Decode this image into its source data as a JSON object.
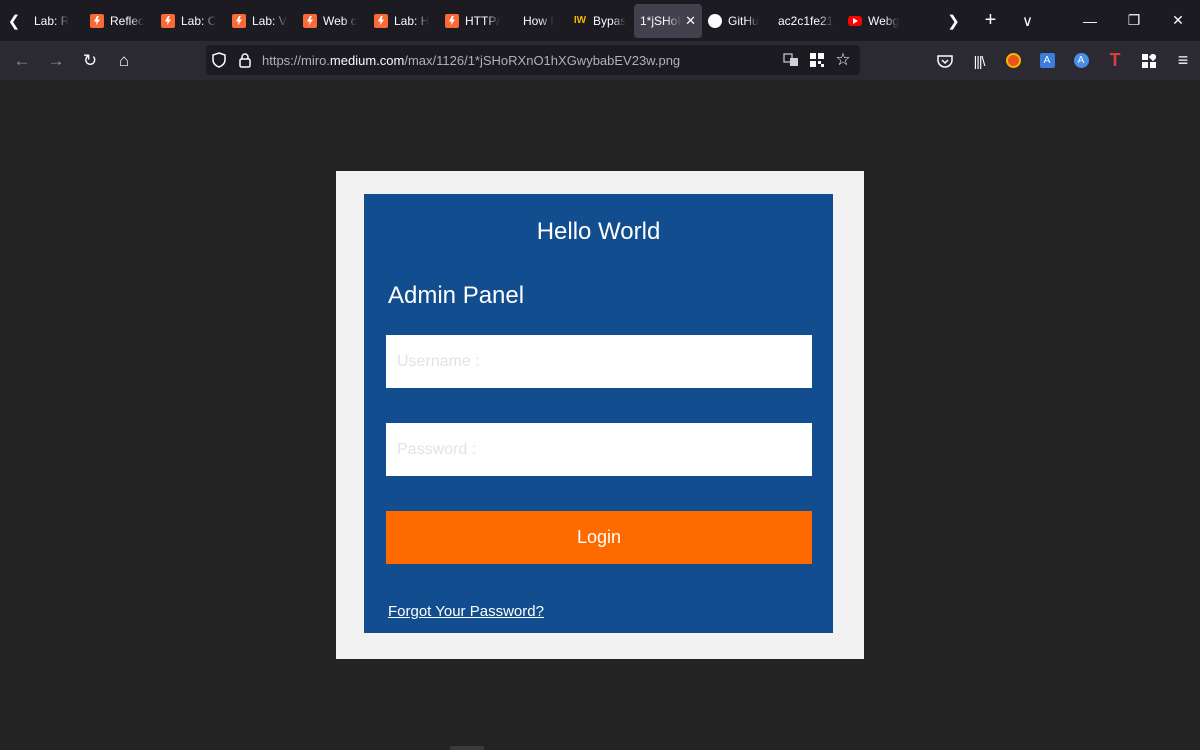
{
  "browser": {
    "tabs": [
      {
        "title": "Lab: R",
        "favicon": "bolt-icon"
      },
      {
        "title": "Reflec",
        "favicon": "bolt-icon"
      },
      {
        "title": "Lab: C",
        "favicon": "bolt-icon"
      },
      {
        "title": "Lab: V",
        "favicon": "bolt-icon"
      },
      {
        "title": "Web c",
        "favicon": "bolt-icon"
      },
      {
        "title": "Lab: H",
        "favicon": "bolt-icon"
      },
      {
        "title": "HTTP/",
        "favicon": "bolt-icon"
      },
      {
        "title": "How I",
        "favicon": "none"
      },
      {
        "title": "Bypas",
        "favicon": "iw-icon",
        "favicon_text": "IW"
      },
      {
        "title": "1*jSHoR",
        "favicon": "none",
        "active": true
      },
      {
        "title": "GitHu",
        "favicon": "github-icon"
      },
      {
        "title": "ac2c1fe21",
        "favicon": "none"
      },
      {
        "title": "Webg",
        "favicon": "youtube-icon"
      }
    ],
    "url_prefix": "https://miro.",
    "url_host": "medium.com",
    "url_path": "/max/1126/1*jSHoRXnO1hXGwybabEV23w.png"
  },
  "page": {
    "heading": "Hello World",
    "panel_title": "Admin Panel",
    "username_placeholder": "Username :",
    "password_placeholder": "Password :",
    "login_label": "Login",
    "forgot_link": "Forgot Your Password?"
  },
  "colors": {
    "panel_bg": "#114d8f",
    "login_button": "#ff6a00",
    "frame_bg": "#f2f2f2",
    "page_bg": "#232323"
  }
}
